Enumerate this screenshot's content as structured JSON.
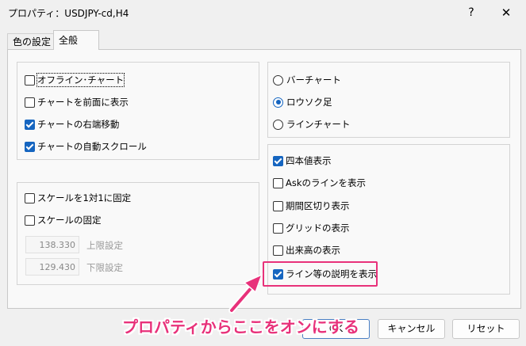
{
  "window": {
    "title": "プロパティ：USDJPY-cd,H4",
    "help_label": "?",
    "close_label": "✕"
  },
  "tabs": [
    {
      "label": "色の設定",
      "active": false
    },
    {
      "label": "全般",
      "active": true
    }
  ],
  "left_group1": [
    {
      "label": "オフライン･チャート",
      "checked": false
    },
    {
      "label": "チャートを前面に表示",
      "checked": false
    },
    {
      "label": "チャートの右端移動",
      "checked": true
    },
    {
      "label": "チャートの自動スクロール",
      "checked": true
    }
  ],
  "left_group2": {
    "scale_1to1": {
      "label": "スケールを1対1に固定",
      "checked": false
    },
    "scale_fixed": {
      "label": "スケールの固定",
      "checked": false
    },
    "upper": {
      "value": "138.330",
      "label": "上限設定"
    },
    "lower": {
      "value": "129.430",
      "label": "下限設定"
    }
  },
  "chart_type": [
    {
      "label": "バーチャート",
      "selected": false
    },
    {
      "label": "ロウソク足",
      "selected": true
    },
    {
      "label": "ラインチャート",
      "selected": false
    }
  ],
  "right_group2": [
    {
      "label": "四本値表示",
      "checked": true
    },
    {
      "label": "Askのラインを表示",
      "checked": false
    },
    {
      "label": "期間区切り表示",
      "checked": false
    },
    {
      "label": "グリッドの表示",
      "checked": false
    },
    {
      "label": "出来高の表示",
      "checked": false
    },
    {
      "label": "ライン等の説明を表示",
      "checked": true
    }
  ],
  "buttons": {
    "ok": "OK",
    "cancel": "キャンセル",
    "reset": "リセット"
  },
  "annotation": {
    "text": "プロパティからここをオンにする",
    "color": "#e8317a"
  },
  "colors": {
    "accent": "#1565c0",
    "highlight": "#e8317a"
  }
}
